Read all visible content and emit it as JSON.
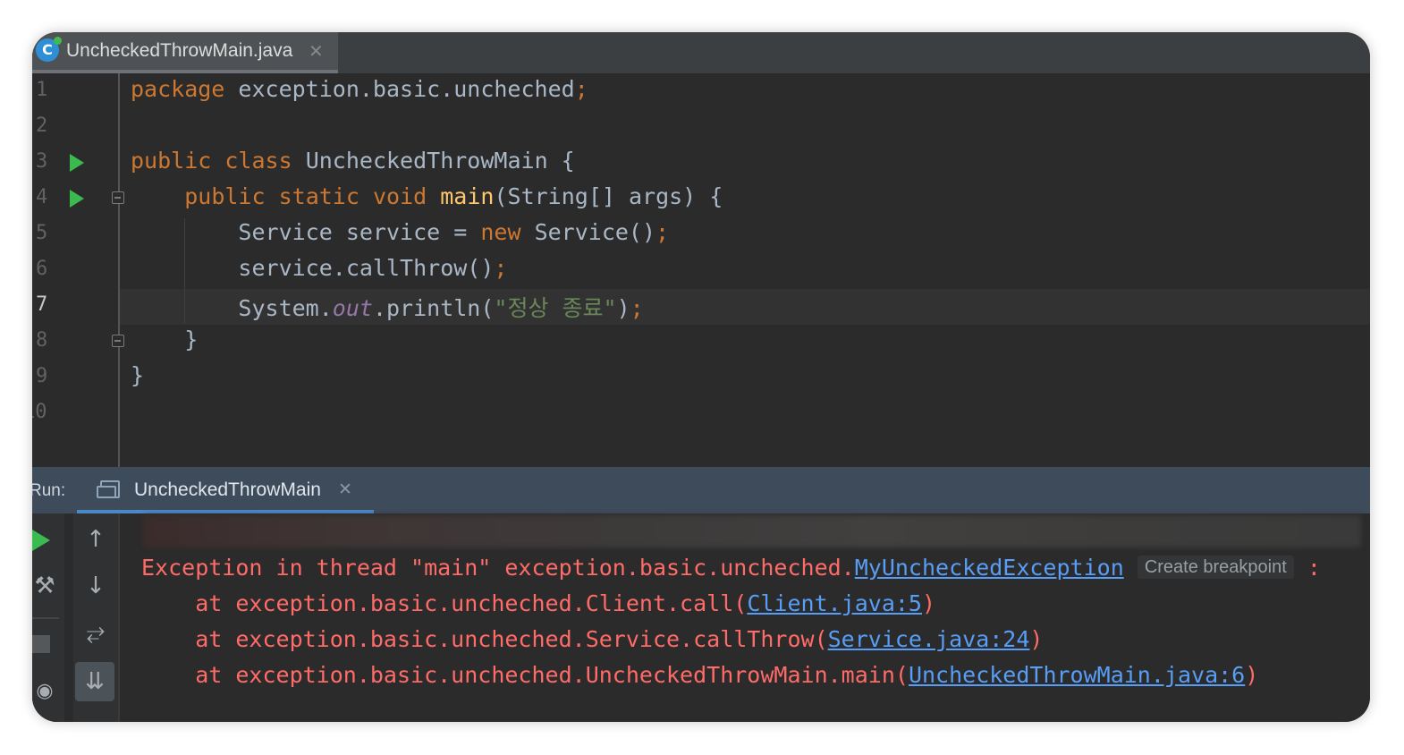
{
  "editor_tab": {
    "file_icon": "C",
    "label": "UncheckedThrowMain.java",
    "close": "✕"
  },
  "code_lines": [
    {
      "num": "1"
    },
    {
      "num": "2"
    },
    {
      "num": "3"
    },
    {
      "num": "4"
    },
    {
      "num": "5"
    },
    {
      "num": "6"
    },
    {
      "num": "7"
    },
    {
      "num": "8"
    },
    {
      "num": "9"
    },
    {
      "num": "10"
    }
  ],
  "code": {
    "l1": {
      "kw": "package",
      "rest": " exception.basic.uncheched",
      "semi": ";"
    },
    "l3": {
      "kw1": "public",
      "kw2": "class",
      "name": " UncheckedThrowMain {"
    },
    "l4": {
      "kw1": "public",
      "kw2": "static",
      "kw3": "void",
      "fn": "main",
      "rest": "(String[] args) {"
    },
    "l5": {
      "pre": "Service service = ",
      "kw": "new",
      "post": " Service()",
      "semi": ";"
    },
    "l6": {
      "text": "service.callThrow()",
      "semi": ";"
    },
    "l7": {
      "pre": "System.",
      "field": "out",
      "mid": ".println(",
      "str": "\"정상 종료\"",
      "post": ")",
      "semi": ";"
    },
    "l8": {
      "text": "}"
    },
    "l9": {
      "text": "}"
    }
  },
  "run_panel": {
    "label": "Run:",
    "tab_label": "UncheckedThrowMain",
    "close": "✕",
    "toolbar": {
      "up": "↑",
      "down": "↓",
      "wrap": "⥂",
      "scroll_end": "⇊",
      "wrench": "🔧"
    }
  },
  "console": {
    "line1_prefix": "Exception in thread \"main\" exception.basic.uncheched.",
    "line1_link": "MyUncheckedException",
    "line1_bp": "Create breakpoint",
    "line1_suffix": " :",
    "line2_prefix": "    at exception.basic.uncheched.Client.call(",
    "line2_link": "Client.java:5",
    "line2_suffix": ")",
    "line3_prefix": "    at exception.basic.uncheched.Service.callThrow(",
    "line3_link": "Service.java:24",
    "line3_suffix": ")",
    "line4_prefix": "    at exception.basic.uncheched.UncheckedThrowMain.main(",
    "line4_link": "UncheckedThrowMain.java:6",
    "line4_suffix": ")"
  }
}
